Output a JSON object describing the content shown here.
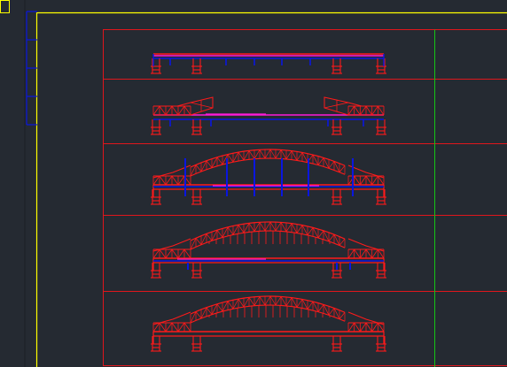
{
  "viewport": {
    "background": "#252a32"
  },
  "colors": {
    "frame": "#ffff00",
    "sheet_border": "#e0161c",
    "bridge_truss": "#ff1a1a",
    "deck_blue": "#0a16e0",
    "deck_magenta": "#ff1ad9",
    "guide_line": "#15c415"
  },
  "panels": [
    {
      "stage": "girder-erection"
    },
    {
      "stage": "cantilever-arm-erection"
    },
    {
      "stage": "arch-closure-with-temporary-supports"
    },
    {
      "stage": "hanger-installation-with-temporary-supports"
    },
    {
      "stage": "completed-bridge"
    }
  ]
}
